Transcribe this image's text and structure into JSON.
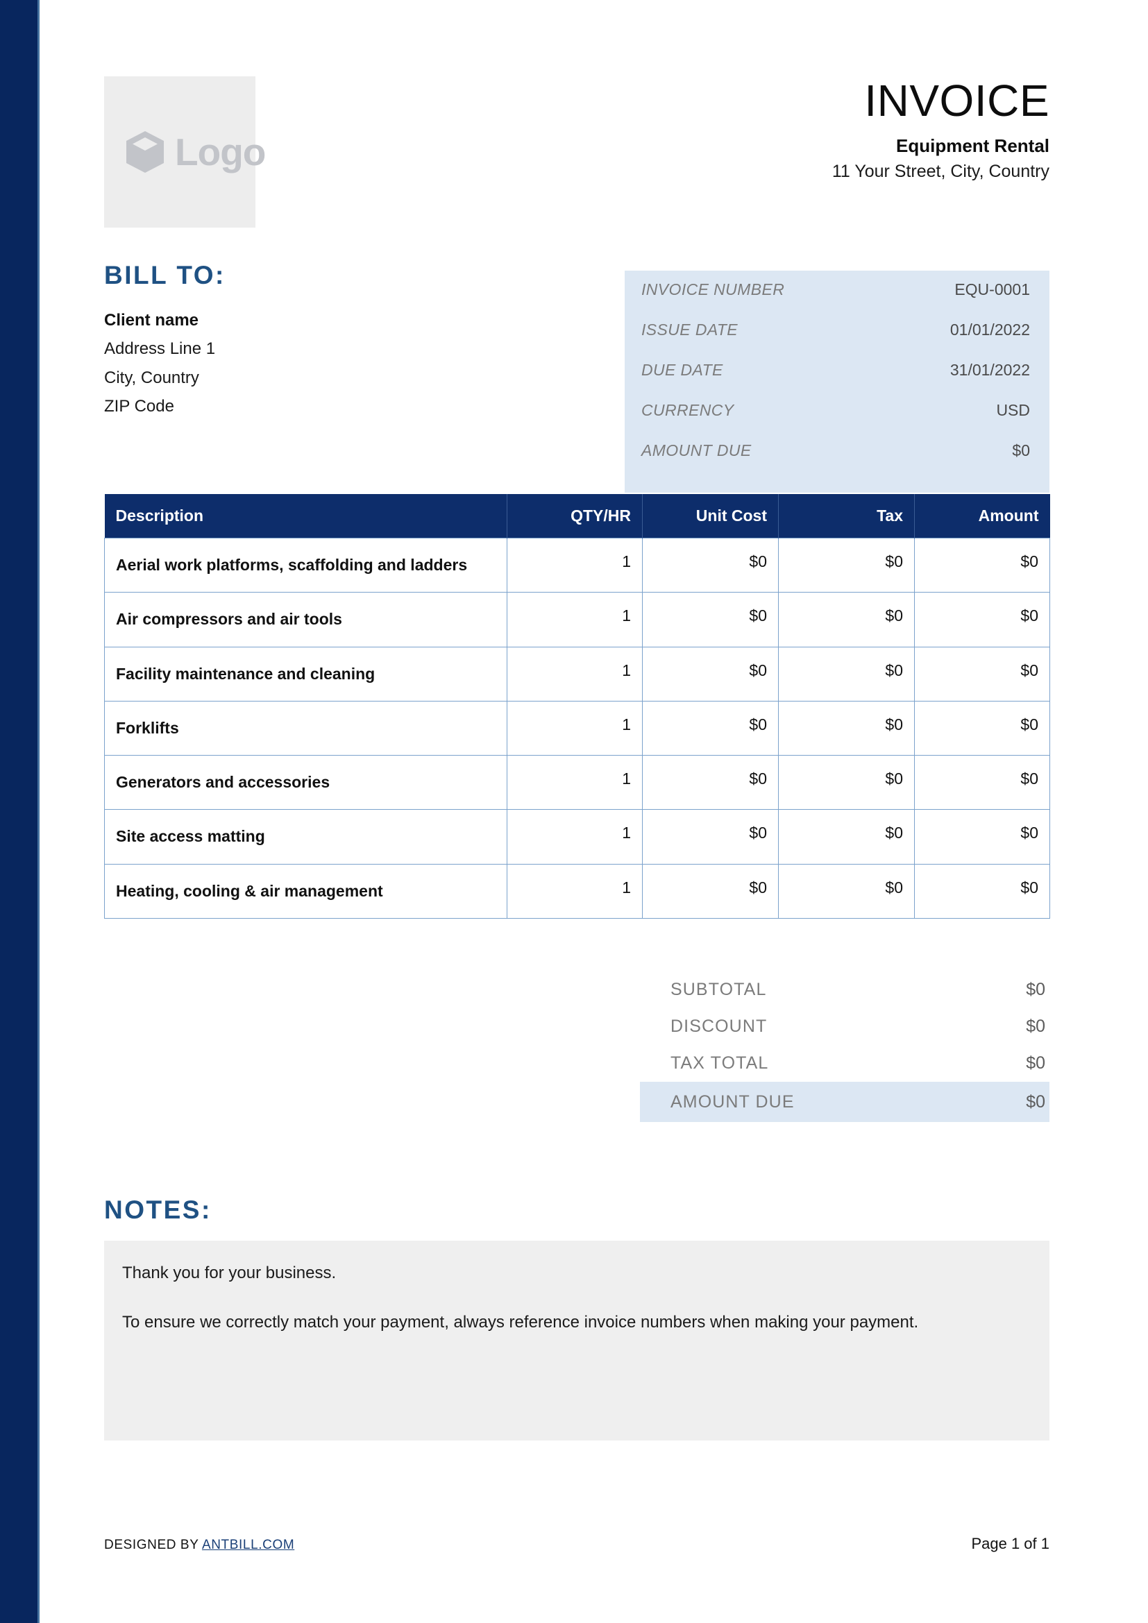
{
  "brand": {
    "stripe_color": "#08265e",
    "accent_color": "#1f5183",
    "table_header_color": "#0d2d6b",
    "highlight_color": "#dce7f3",
    "logo_placeholder_text": "Logo",
    "logo_icon": "cube-icon"
  },
  "header": {
    "title": "INVOICE",
    "company_name": "Equipment Rental",
    "company_address": "11 Your Street, City, Country"
  },
  "bill_to": {
    "heading": "BILL TO:",
    "client_name": "Client name",
    "address_line_1": "Address Line 1",
    "city_country": "City, Country",
    "zip_code": "ZIP Code"
  },
  "meta": {
    "rows": [
      {
        "label": "INVOICE NUMBER",
        "value": "EQU-0001"
      },
      {
        "label": "ISSUE DATE",
        "value": "01/01/2022"
      },
      {
        "label": "DUE DATE",
        "value": "31/01/2022"
      },
      {
        "label": "CURRENCY",
        "value": "USD"
      },
      {
        "label": "AMOUNT DUE",
        "value": "$0"
      }
    ]
  },
  "items": {
    "columns": [
      "Description",
      "QTY/HR",
      "Unit Cost",
      "Tax",
      "Amount"
    ],
    "rows": [
      {
        "description": "Aerial work platforms, scaffolding and ladders",
        "qty": "1",
        "unit_cost": "$0",
        "tax": "$0",
        "amount": "$0"
      },
      {
        "description": "Air compressors and air tools",
        "qty": "1",
        "unit_cost": "$0",
        "tax": "$0",
        "amount": "$0"
      },
      {
        "description": "Facility maintenance and cleaning",
        "qty": "1",
        "unit_cost": "$0",
        "tax": "$0",
        "amount": "$0"
      },
      {
        "description": "Forklifts",
        "qty": "1",
        "unit_cost": "$0",
        "tax": "$0",
        "amount": "$0"
      },
      {
        "description": "Generators and accessories",
        "qty": "1",
        "unit_cost": "$0",
        "tax": "$0",
        "amount": "$0"
      },
      {
        "description": "Site access matting",
        "qty": "1",
        "unit_cost": "$0",
        "tax": "$0",
        "amount": "$0"
      },
      {
        "description": "Heating, cooling & air management",
        "qty": "1",
        "unit_cost": "$0",
        "tax": "$0",
        "amount": "$0"
      }
    ]
  },
  "totals": {
    "rows": [
      {
        "label": "SUBTOTAL",
        "value": "$0",
        "highlight": false
      },
      {
        "label": "DISCOUNT",
        "value": "$0",
        "highlight": false
      },
      {
        "label": "TAX TOTAL",
        "value": "$0",
        "highlight": false
      },
      {
        "label": "AMOUNT DUE",
        "value": "$0",
        "highlight": true
      }
    ]
  },
  "notes": {
    "heading": "NOTES:",
    "paragraphs": [
      "Thank you for your business.",
      "To ensure we correctly match your payment, always reference invoice numbers when making your payment."
    ]
  },
  "footer": {
    "designed_by_prefix": "DESIGNED BY ",
    "designed_by_link": "ANTBILL.COM",
    "page_indicator": "Page 1 of 1"
  }
}
